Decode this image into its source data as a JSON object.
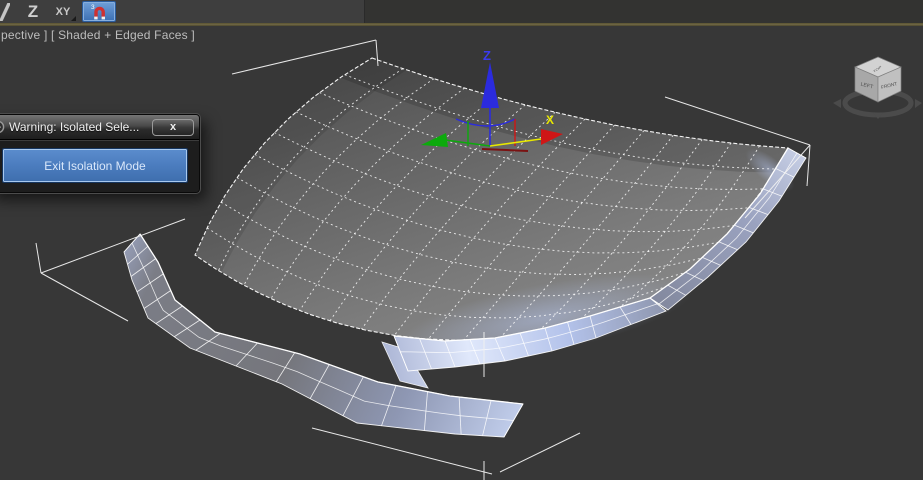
{
  "toolbar": {
    "z_button_label": "Z",
    "xy_button_label": "XY",
    "snap_superscript": "3",
    "snaps_active": true
  },
  "viewport": {
    "label": "pective ] [ Shaded + Edged Faces ]"
  },
  "dialog": {
    "title": "Warning: Isolated Sele...",
    "close_label": "x",
    "exit_button_label": "Exit Isolation Mode"
  },
  "gizmo": {
    "x_label": "X",
    "z_label": "Z"
  },
  "viewcube": {
    "top_label": "TOP",
    "left_label": "LEFT",
    "front_label": "FRONT"
  },
  "colors": {
    "viewport_bg": "#373737",
    "active_viewport_border": "#6b6342",
    "accent_blue": "#4a7bbd",
    "axis_x": "#cf1616",
    "axis_y": "#0caa0c",
    "axis_z": "#2b2bde",
    "selected_axis": "#e8e800",
    "wireframe": "#ffffff"
  }
}
